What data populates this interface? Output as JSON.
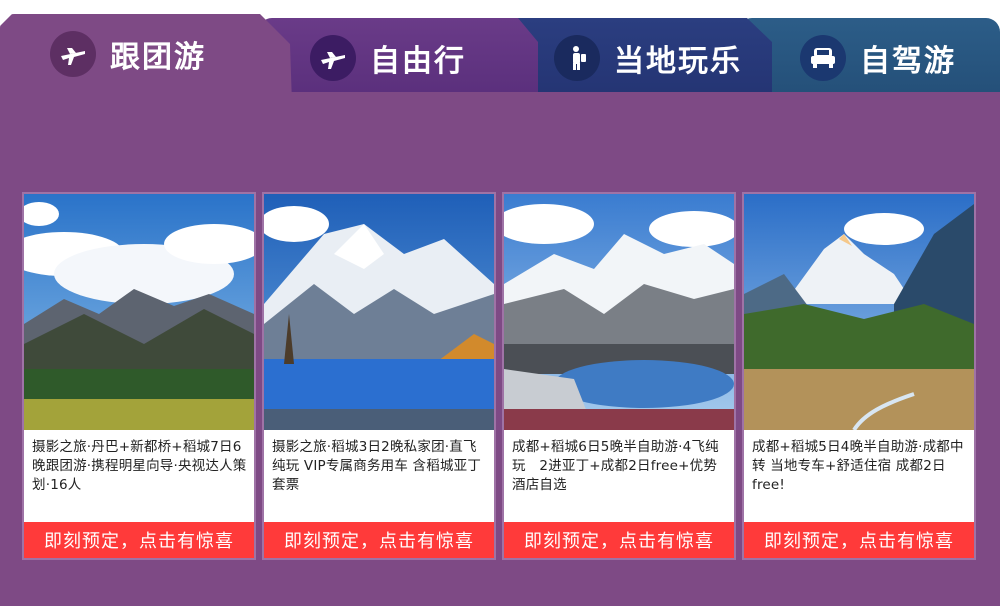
{
  "tabs": [
    {
      "label": "跟团游",
      "icon": "airplane-icon"
    },
    {
      "label": "自由行",
      "icon": "airplane-icon"
    },
    {
      "label": "当地玩乐",
      "icon": "traveler-icon"
    },
    {
      "label": "自驾游",
      "icon": "car-icon"
    }
  ],
  "cards": [
    {
      "title": "摄影之旅·丹巴+新都桥+稻城7日6晚跟团游·携程明星向导·央视达人策划·16人",
      "cta": "即刻预定，点击有惊喜"
    },
    {
      "title": "摄影之旅·稻城3日2晚私家团·直飞纯玩 VIP专属商务用车 含稻城亚丁套票",
      "cta": "即刻预定，点击有惊喜"
    },
    {
      "title": "成都+稻城6日5晚半自助游·4飞纯玩　2进亚丁+成都2日free+优势酒店自选",
      "cta": "即刻预定，点击有惊喜"
    },
    {
      "title": "成都+稻城5日4晚半自助游·成都中转 当地专车+舒适住宿 成都2日free!",
      "cta": "即刻预定，点击有惊喜"
    }
  ],
  "colors": {
    "panel": "#7e4a85",
    "cta": "#ff3a3a",
    "tab_free": "#5a2f7c",
    "tab_local": "#243473",
    "tab_drive": "#244f78"
  }
}
